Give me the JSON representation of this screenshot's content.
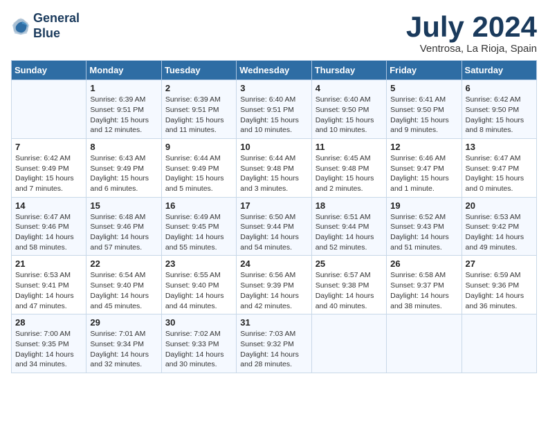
{
  "header": {
    "logo_line1": "General",
    "logo_line2": "Blue",
    "month_title": "July 2024",
    "location": "Ventrosa, La Rioja, Spain"
  },
  "days_of_week": [
    "Sunday",
    "Monday",
    "Tuesday",
    "Wednesday",
    "Thursday",
    "Friday",
    "Saturday"
  ],
  "weeks": [
    [
      {
        "day": "",
        "content": ""
      },
      {
        "day": "1",
        "content": "Sunrise: 6:39 AM\nSunset: 9:51 PM\nDaylight: 15 hours\nand 12 minutes."
      },
      {
        "day": "2",
        "content": "Sunrise: 6:39 AM\nSunset: 9:51 PM\nDaylight: 15 hours\nand 11 minutes."
      },
      {
        "day": "3",
        "content": "Sunrise: 6:40 AM\nSunset: 9:51 PM\nDaylight: 15 hours\nand 10 minutes."
      },
      {
        "day": "4",
        "content": "Sunrise: 6:40 AM\nSunset: 9:50 PM\nDaylight: 15 hours\nand 10 minutes."
      },
      {
        "day": "5",
        "content": "Sunrise: 6:41 AM\nSunset: 9:50 PM\nDaylight: 15 hours\nand 9 minutes."
      },
      {
        "day": "6",
        "content": "Sunrise: 6:42 AM\nSunset: 9:50 PM\nDaylight: 15 hours\nand 8 minutes."
      }
    ],
    [
      {
        "day": "7",
        "content": "Sunrise: 6:42 AM\nSunset: 9:49 PM\nDaylight: 15 hours\nand 7 minutes."
      },
      {
        "day": "8",
        "content": "Sunrise: 6:43 AM\nSunset: 9:49 PM\nDaylight: 15 hours\nand 6 minutes."
      },
      {
        "day": "9",
        "content": "Sunrise: 6:44 AM\nSunset: 9:49 PM\nDaylight: 15 hours\nand 5 minutes."
      },
      {
        "day": "10",
        "content": "Sunrise: 6:44 AM\nSunset: 9:48 PM\nDaylight: 15 hours\nand 3 minutes."
      },
      {
        "day": "11",
        "content": "Sunrise: 6:45 AM\nSunset: 9:48 PM\nDaylight: 15 hours\nand 2 minutes."
      },
      {
        "day": "12",
        "content": "Sunrise: 6:46 AM\nSunset: 9:47 PM\nDaylight: 15 hours\nand 1 minute."
      },
      {
        "day": "13",
        "content": "Sunrise: 6:47 AM\nSunset: 9:47 PM\nDaylight: 15 hours\nand 0 minutes."
      }
    ],
    [
      {
        "day": "14",
        "content": "Sunrise: 6:47 AM\nSunset: 9:46 PM\nDaylight: 14 hours\nand 58 minutes."
      },
      {
        "day": "15",
        "content": "Sunrise: 6:48 AM\nSunset: 9:46 PM\nDaylight: 14 hours\nand 57 minutes."
      },
      {
        "day": "16",
        "content": "Sunrise: 6:49 AM\nSunset: 9:45 PM\nDaylight: 14 hours\nand 55 minutes."
      },
      {
        "day": "17",
        "content": "Sunrise: 6:50 AM\nSunset: 9:44 PM\nDaylight: 14 hours\nand 54 minutes."
      },
      {
        "day": "18",
        "content": "Sunrise: 6:51 AM\nSunset: 9:44 PM\nDaylight: 14 hours\nand 52 minutes."
      },
      {
        "day": "19",
        "content": "Sunrise: 6:52 AM\nSunset: 9:43 PM\nDaylight: 14 hours\nand 51 minutes."
      },
      {
        "day": "20",
        "content": "Sunrise: 6:53 AM\nSunset: 9:42 PM\nDaylight: 14 hours\nand 49 minutes."
      }
    ],
    [
      {
        "day": "21",
        "content": "Sunrise: 6:53 AM\nSunset: 9:41 PM\nDaylight: 14 hours\nand 47 minutes."
      },
      {
        "day": "22",
        "content": "Sunrise: 6:54 AM\nSunset: 9:40 PM\nDaylight: 14 hours\nand 45 minutes."
      },
      {
        "day": "23",
        "content": "Sunrise: 6:55 AM\nSunset: 9:40 PM\nDaylight: 14 hours\nand 44 minutes."
      },
      {
        "day": "24",
        "content": "Sunrise: 6:56 AM\nSunset: 9:39 PM\nDaylight: 14 hours\nand 42 minutes."
      },
      {
        "day": "25",
        "content": "Sunrise: 6:57 AM\nSunset: 9:38 PM\nDaylight: 14 hours\nand 40 minutes."
      },
      {
        "day": "26",
        "content": "Sunrise: 6:58 AM\nSunset: 9:37 PM\nDaylight: 14 hours\nand 38 minutes."
      },
      {
        "day": "27",
        "content": "Sunrise: 6:59 AM\nSunset: 9:36 PM\nDaylight: 14 hours\nand 36 minutes."
      }
    ],
    [
      {
        "day": "28",
        "content": "Sunrise: 7:00 AM\nSunset: 9:35 PM\nDaylight: 14 hours\nand 34 minutes."
      },
      {
        "day": "29",
        "content": "Sunrise: 7:01 AM\nSunset: 9:34 PM\nDaylight: 14 hours\nand 32 minutes."
      },
      {
        "day": "30",
        "content": "Sunrise: 7:02 AM\nSunset: 9:33 PM\nDaylight: 14 hours\nand 30 minutes."
      },
      {
        "day": "31",
        "content": "Sunrise: 7:03 AM\nSunset: 9:32 PM\nDaylight: 14 hours\nand 28 minutes."
      },
      {
        "day": "",
        "content": ""
      },
      {
        "day": "",
        "content": ""
      },
      {
        "day": "",
        "content": ""
      }
    ]
  ]
}
